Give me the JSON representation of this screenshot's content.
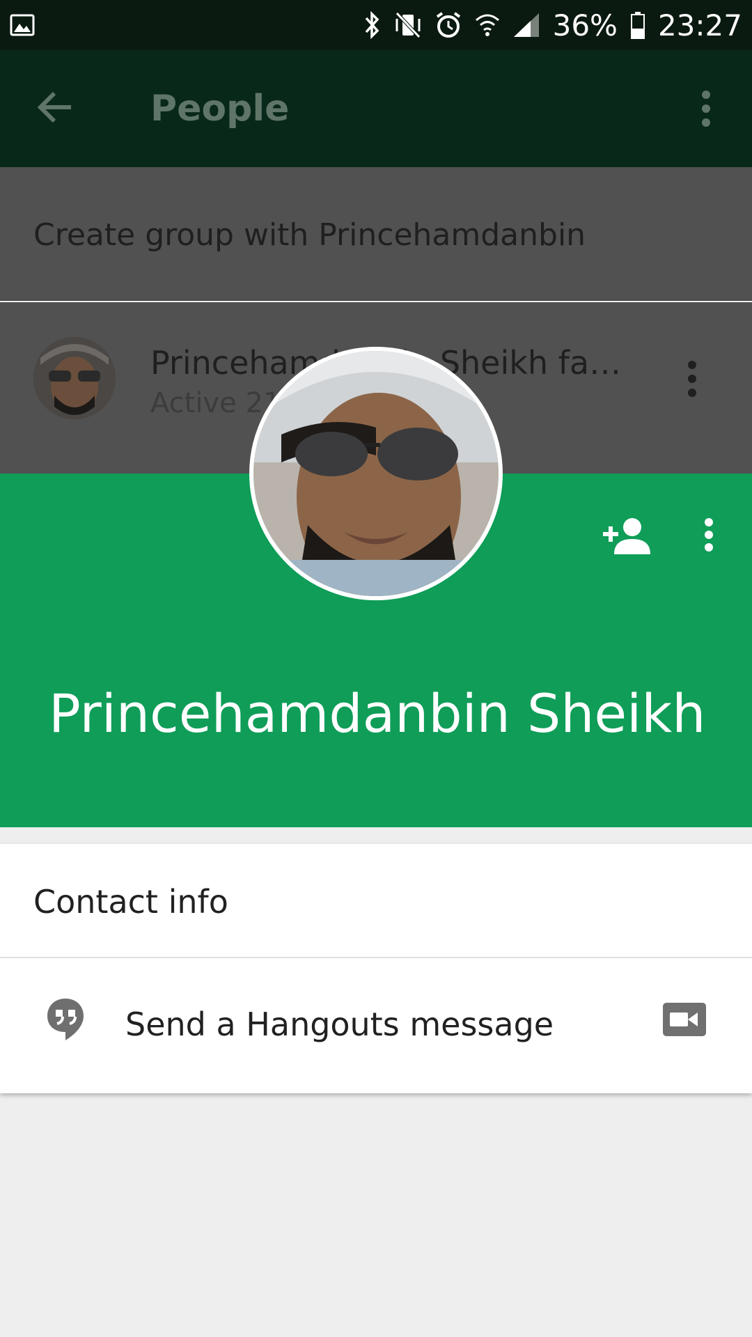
{
  "status_bar": {
    "battery": "36%",
    "time": "23:27",
    "icons": [
      "gallery-icon",
      "bluetooth-icon",
      "vibrate-icon",
      "alarm-icon",
      "wifi-icon",
      "signal-icon",
      "battery-icon"
    ]
  },
  "appbar": {
    "title": "People",
    "back_icon": "arrow-back-icon",
    "menu_icon": "more-vert-icon"
  },
  "people_list": {
    "create_group": "Create group with Princehamdanbin",
    "contact": {
      "name": "Princehamdanbin Sheikh fazza...",
      "status": "Active 21"
    }
  },
  "profile_card": {
    "name": "Princehamdanbin Sheikh …",
    "add_person_icon": "person-add-icon",
    "menu_icon": "more-vert-icon",
    "color": "#0f9d58"
  },
  "actions": {
    "contact_info": "Contact info",
    "hangouts_message": "Send a Hangouts message",
    "hangouts_icon": "hangouts-quote-icon",
    "video_icon": "video-call-icon"
  }
}
